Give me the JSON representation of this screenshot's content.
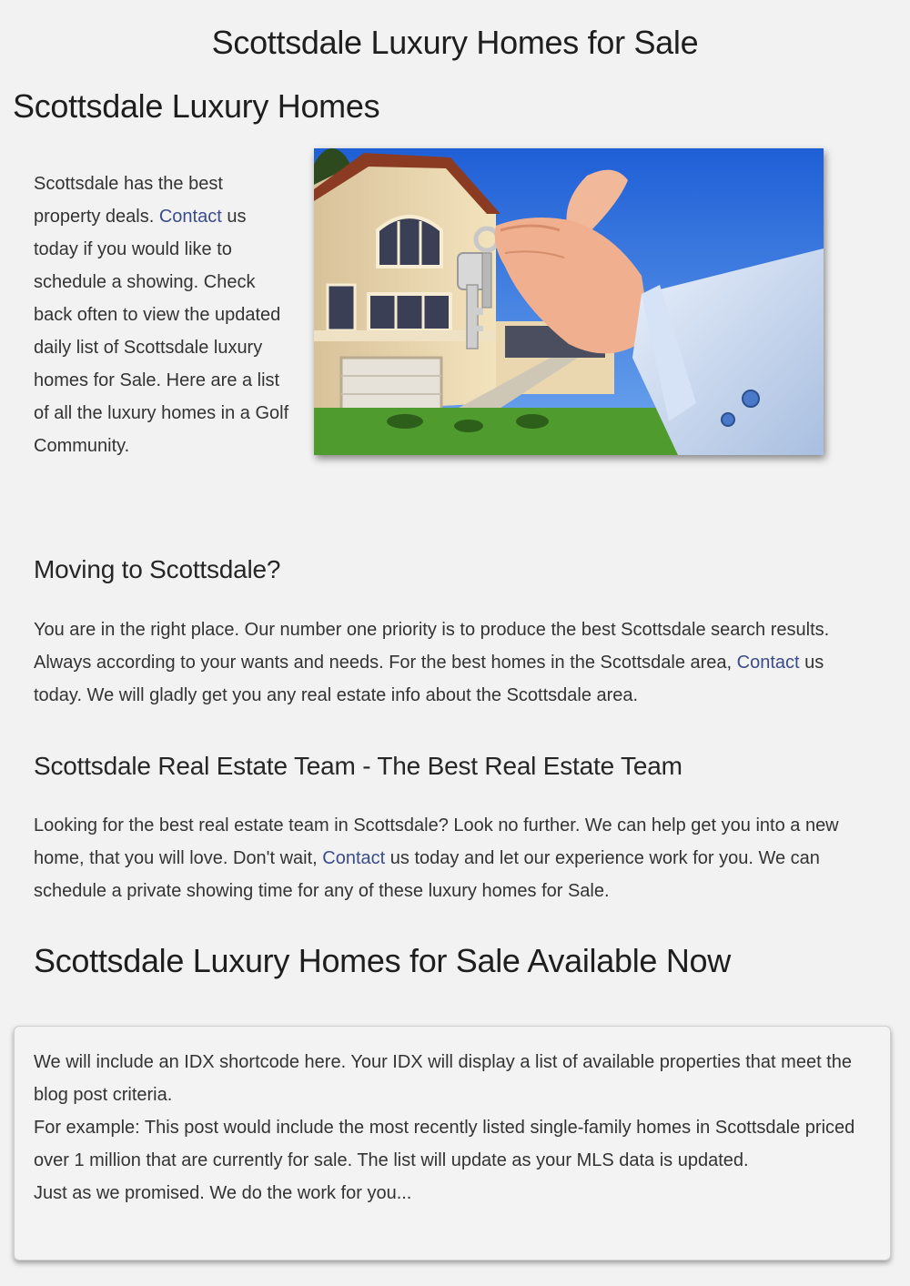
{
  "page": {
    "title": "Scottsdale Luxury Homes for Sale"
  },
  "intro": {
    "heading": "Scottsdale Luxury Homes",
    "text_before_link": "Scottsdale has the best property deals. ",
    "link": "Contact",
    "text_after_link": " us today if you would like to schedule a showing. Check back often to view the updated daily list of Scottsdale luxury homes for Sale. Here are a list of all the luxury homes in a Golf Community."
  },
  "moving": {
    "heading": "Moving to Scottsdale?",
    "text_before_link": "You are in the right place. Our number one priority is to produce the best Scottsdale search results. Always according to your wants and needs. For the best homes in the Scottsdale area, ",
    "link": "Contact",
    "text_after_link": " us today. We will gladly get you any real estate info about the Scottsdale area."
  },
  "team": {
    "heading": "Scottsdale Real Estate Team - The Best Real Estate Team",
    "text_before_link": "Looking for the best real estate team in Scottsdale? Look no further. We can help get you into a new home, that you will love. Don't wait, ",
    "link": "Contact",
    "text_after_link": " us today and let our experience work for you. We can schedule a private showing time for any of these luxury homes for Sale."
  },
  "available": {
    "heading": "Scottsdale Luxury Homes for Sale Available Now"
  },
  "idx": {
    "line1": "We will include an IDX shortcode here. Your IDX will display a list of available properties that meet the blog post criteria.",
    "line2": "For example: This post would include the most recently listed single-family homes in Scottsdale priced over 1 million that are currently for sale. The list will update as your MLS data is updated.",
    "line3": "Just as we promised. We do the work for you..."
  },
  "colors": {
    "background": "#f2f2f2",
    "link": "#3a4c8a",
    "text": "#333333"
  }
}
